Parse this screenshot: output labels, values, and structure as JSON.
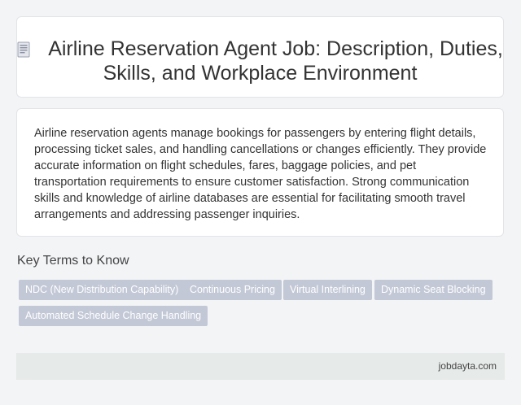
{
  "header": {
    "icon": "document-icon",
    "title": "Airline Reservation Agent Job: Description, Duties, Skills, and Workplace Environment"
  },
  "description": "Airline reservation agents manage bookings for passengers by entering flight details, processing ticket sales, and handling cancellations or changes efficiently. They provide accurate information on flight schedules, fares, baggage policies, and pet transportation requirements to ensure customer satisfaction. Strong communication skills and knowledge of airline databases are essential for facilitating smooth travel arrangements and addressing passenger inquiries.",
  "key_terms": {
    "heading": "Key Terms to Know",
    "tags": [
      "NDC (New Distribution Capability)",
      "Continuous Pricing",
      "Virtual Interlining",
      "Dynamic Seat Blocking",
      "Automated Schedule Change Handling"
    ]
  },
  "footer": {
    "text": "jobdayta.com"
  },
  "colors": {
    "tag_background": "#c3c8d6",
    "footer_background": "#e6eae8",
    "page_background": "#f3f4f6"
  }
}
